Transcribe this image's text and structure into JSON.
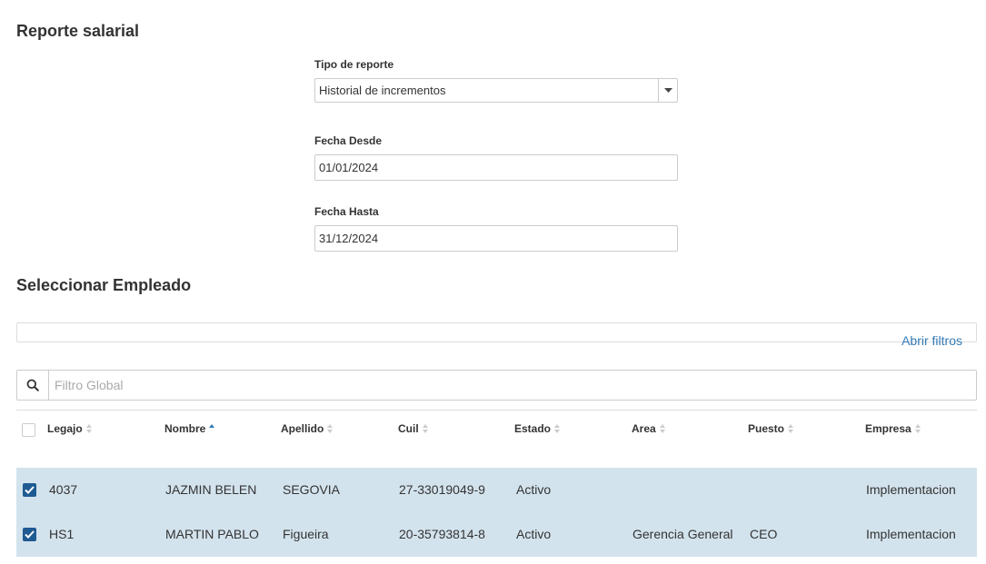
{
  "page_title": "Reporte salarial",
  "form": {
    "tipo_label": "Tipo de reporte",
    "tipo_value": "Historial de incrementos",
    "desde_label": "Fecha Desde",
    "desde_value": "01/01/2024",
    "hasta_label": "Fecha Hasta",
    "hasta_value": "31/12/2024"
  },
  "employee_section_title": "Seleccionar Empleado",
  "filters_link": "Abrir filtros",
  "search": {
    "placeholder": "Filtro Global"
  },
  "table": {
    "columns": [
      "Legajo",
      "Nombre",
      "Apellido",
      "Cuil",
      "Estado",
      "Area",
      "Puesto",
      "Empresa"
    ],
    "sorted_column": "Nombre",
    "rows": [
      {
        "selected": true,
        "legajo": "4037",
        "nombre": "JAZMIN BELEN",
        "apellido": "SEGOVIA",
        "cuil": "27-33019049-9",
        "estado": "Activo",
        "area": "",
        "puesto": "",
        "empresa": "Implementacion"
      },
      {
        "selected": true,
        "legajo": "HS1",
        "nombre": "MARTIN PABLO",
        "apellido": "Figueira",
        "cuil": "20-35793814-8",
        "estado": "Activo",
        "area": "Gerencia General",
        "puesto": "CEO",
        "empresa": "Implementacion"
      }
    ]
  },
  "colors": {
    "accent": "#337ab7",
    "row_selected": "#d3e3ed",
    "checkbox": "#1f5a92"
  },
  "icons": {
    "search": "search-icon",
    "dropdown": "caret-down-icon",
    "check": "check-icon"
  }
}
